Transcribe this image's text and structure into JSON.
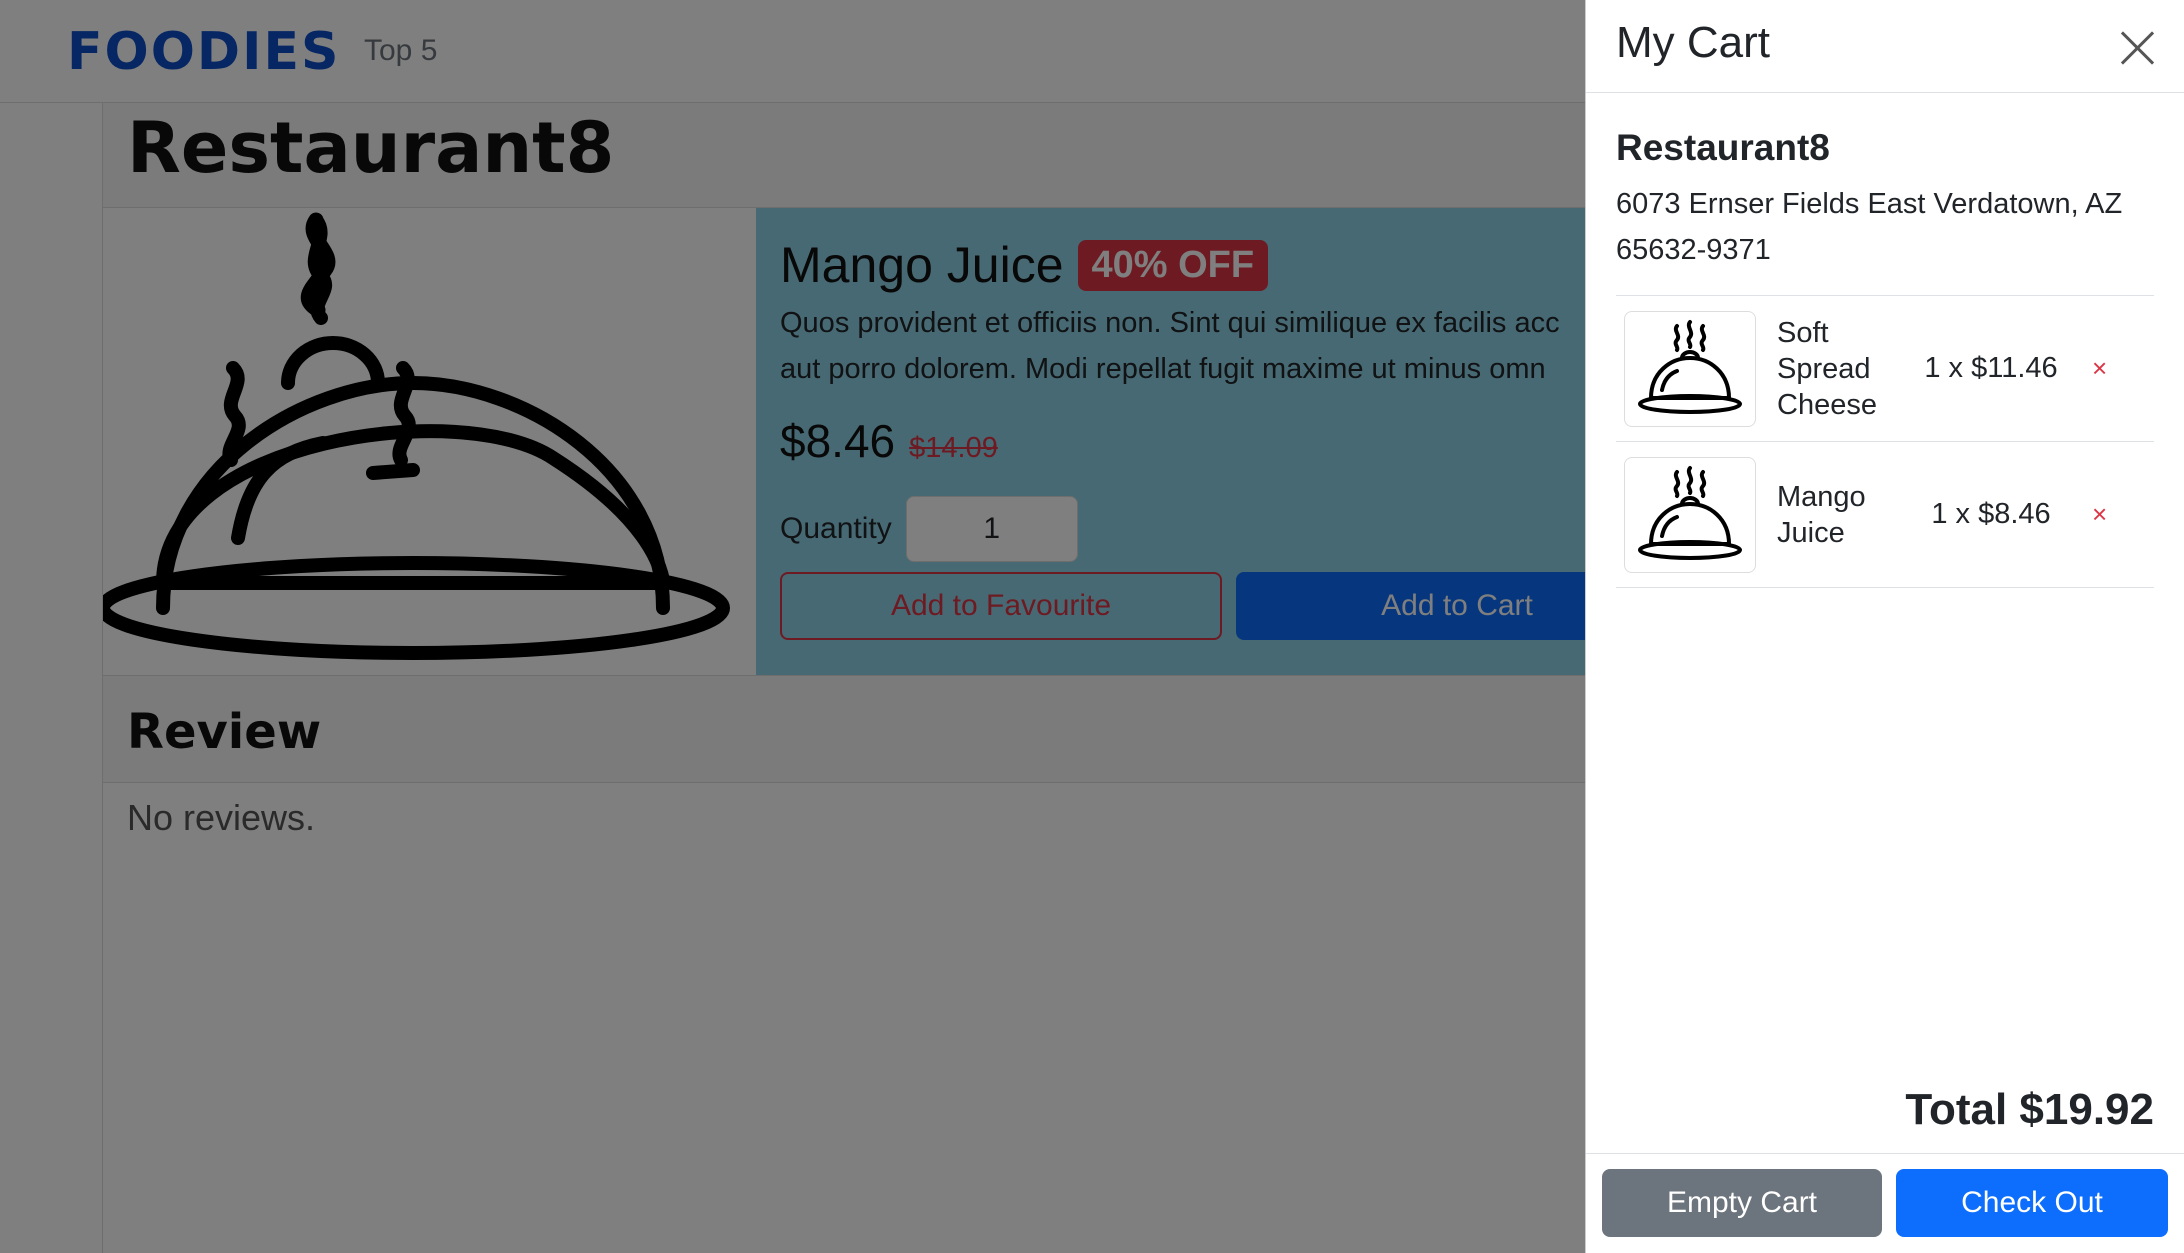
{
  "navbar": {
    "brand": "FOODIES",
    "links": [
      "Top 5"
    ]
  },
  "restaurant": {
    "name": "Restaurant8"
  },
  "product": {
    "name": "Mango Juice",
    "discount_badge": "40% OFF",
    "description_line1": "Quos provident et officiis non. Sint qui similique ex facilis acc",
    "description_line2": "aut porro dolorem. Modi repellat fugit maxime ut minus omn",
    "price": "$8.46",
    "old_price": "$14.09",
    "quantity_label": "Quantity",
    "quantity_value": "1",
    "add_favourite_label": "Add to Favourite",
    "add_cart_label": "Add to Cart",
    "image_icon": "cloche-icon"
  },
  "reviews": {
    "title": "Review",
    "empty_text": "No reviews."
  },
  "cart": {
    "title": "My Cart",
    "restaurant_name": "Restaurant8",
    "restaurant_address_line1": "6073 Ernser Fields East Verdatown, AZ",
    "restaurant_address_line2": "65632-9371",
    "items": [
      {
        "name": "Soft Spread Cheese",
        "qty_price": "1 x $11.46",
        "icon": "cloche-icon",
        "remove_icon": "close-icon"
      },
      {
        "name": "Mango Juice",
        "qty_price": "1 x $8.46",
        "icon": "cloche-icon",
        "remove_icon": "close-icon"
      }
    ],
    "remove_symbol": "×",
    "total": "Total $19.92",
    "empty_label": "Empty Cart",
    "checkout_label": "Check Out"
  },
  "colors": {
    "brand": "#0d4fc9",
    "primary": "#0d6efd",
    "danger": "#dc3545",
    "secondary": "#6c757d",
    "product_bg": "#8ed3e6"
  }
}
